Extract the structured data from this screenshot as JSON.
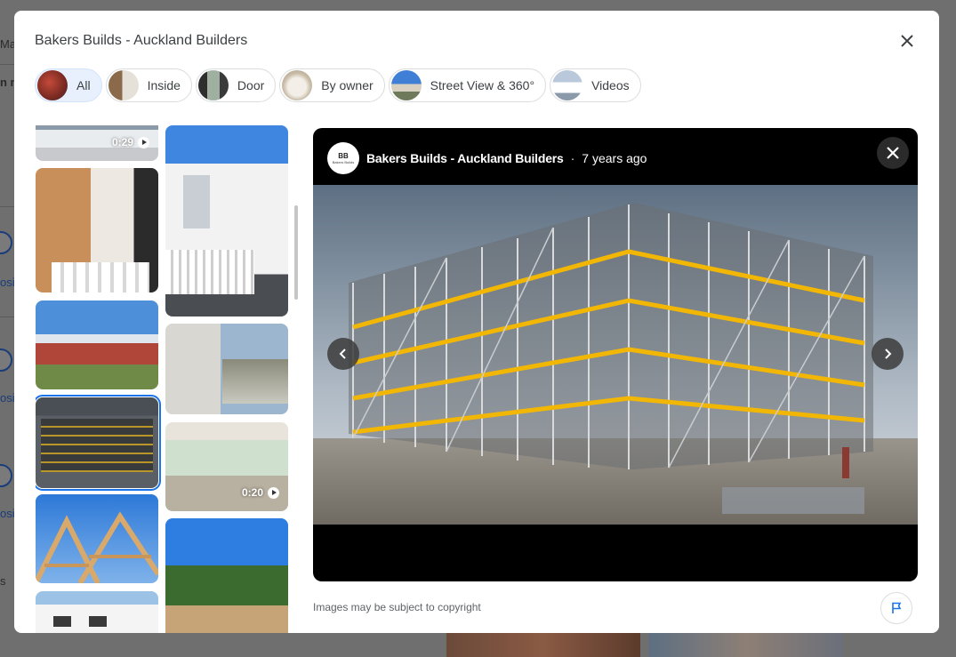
{
  "background": {
    "fragments": [
      "Ma",
      "n n",
      "osit",
      "osit",
      "osit",
      "s"
    ]
  },
  "modal": {
    "title": "Bakers Builds - Auckland Builders",
    "close_icon": "close-icon"
  },
  "filters": [
    {
      "label": "All",
      "active": true
    },
    {
      "label": "Inside",
      "active": false
    },
    {
      "label": "Door",
      "active": false
    },
    {
      "label": "By owner",
      "active": false
    },
    {
      "label": "Street View & 360°",
      "active": false
    },
    {
      "label": "Videos",
      "active": false
    }
  ],
  "gallery": {
    "left_column": [
      {
        "desc": "house-exterior-video",
        "duration": "0:29"
      },
      {
        "desc": "interior-dining"
      },
      {
        "desc": "building-frame-sky"
      },
      {
        "desc": "scaffolding-building",
        "selected": true
      },
      {
        "desc": "roof-trusses"
      },
      {
        "desc": "house-white"
      }
    ],
    "right_column": [
      {
        "desc": "white-villa-stairs"
      },
      {
        "desc": "concrete-wall-mountains"
      },
      {
        "desc": "living-room-video",
        "duration": "0:20"
      },
      {
        "desc": "garden-deck"
      }
    ]
  },
  "viewer": {
    "author": "Bakers Builds - Auckland Builders",
    "separator": "·",
    "time_ago": "7 years ago",
    "avatar_initials": "BB",
    "avatar_name": "Bakers Builds",
    "prev_icon": "chevron-left-icon",
    "next_icon": "chevron-right-icon"
  },
  "footer": {
    "copyright": "Images may be subject to copyright",
    "report_icon": "flag-icon"
  },
  "colors": {
    "accent": "#1a73e8",
    "chip_active_bg": "#e8f0fe",
    "scaffold_yellow": "#f2b705"
  }
}
